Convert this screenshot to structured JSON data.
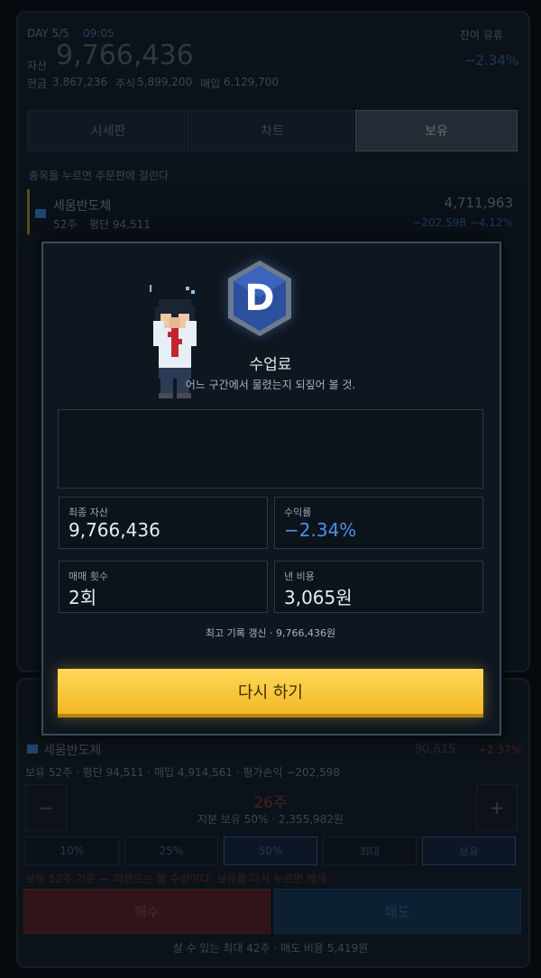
{
  "header": {
    "day": "DAY 5/5",
    "time": "09:05",
    "asset_label": "자산",
    "asset_value": "9,766,436",
    "right_label": "잔여 유휴",
    "change": "−2.34%",
    "cash_label": "현금",
    "cash_value": "3,867,236",
    "stock_label": "주식",
    "stock_value": "5,899,200",
    "invest_label": "매입",
    "invest_value": "6,129,700"
  },
  "tabs": [
    {
      "label": "시세판"
    },
    {
      "label": "차트"
    },
    {
      "label": "보유"
    }
  ],
  "hint": "종목을 누르면 주문판에 걸린다",
  "holding": {
    "name": "세움반도체",
    "shares": "52주",
    "avg": "평단 94,511",
    "value": "4,711,963",
    "pnl": "−202,598  −4.12%"
  },
  "order": {
    "name": "세움반도체",
    "price": "90,615",
    "change": "+2.37%",
    "detail": "보유 52주 · 평단 94,511 · 매입 4,914,561 · 평가손익 −202,598",
    "qty": "26주",
    "qty_sub": "지분 보유 50% · 2,355,982원",
    "minus": "−",
    "plus": "+",
    "pct_buttons": [
      "10%",
      "25%",
      "50%",
      "최대",
      "보유"
    ],
    "note": "보유 52주 기준 — 퍼센트는 팔 수량이다. 보유를 다시 누르면 해제",
    "buy_label": "매수",
    "sell_label": "매도",
    "footer": "살 수 있는 최대 42주 · 매도 비용 5,419원"
  },
  "modal": {
    "grade": "D",
    "title": "수업료",
    "subtitle": "어느 구간에서 물렸는지 되짚어 볼 것.",
    "stats": {
      "final_label": "최종 자산",
      "final_value": "9,766,436",
      "return_label": "수익률",
      "return_value": "−2.34%",
      "trades_label": "매매 횟수",
      "trades_value": "2회",
      "cost_label": "낸 비용",
      "cost_value": "3,065원"
    },
    "record": "최고 기록 갱신 · 9,766,436원",
    "retry_label": "다시 하기"
  },
  "colors": {
    "retry_button": "#f5c533",
    "negative_return": "#4f8ee8",
    "grade_badge": "#2c4f9e"
  }
}
